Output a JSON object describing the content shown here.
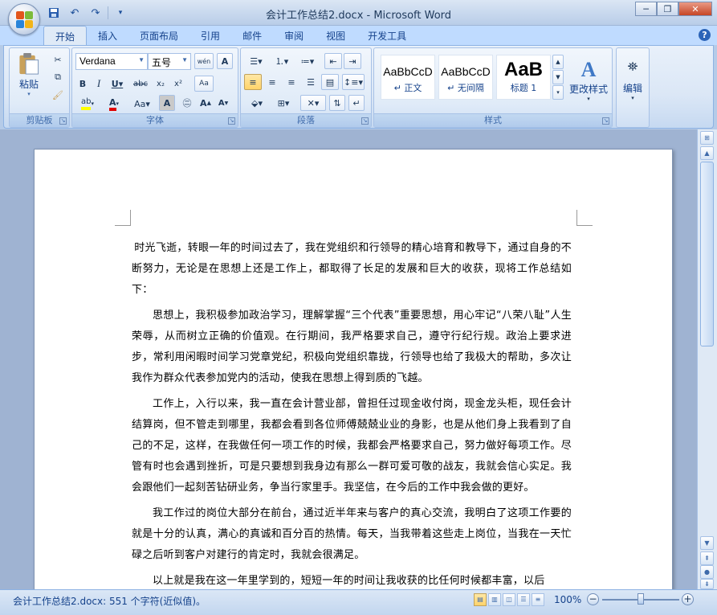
{
  "window": {
    "title": "会计工作总结2.docx - Microsoft Word",
    "minimize": "─",
    "restore": "❐",
    "close": "✕"
  },
  "qat": {
    "save_icon": "save-icon",
    "undo_icon": "undo-icon",
    "redo_icon": "redo-icon",
    "customize_icon": "chevron-down-icon"
  },
  "tabs": [
    {
      "label": "开始",
      "active": true
    },
    {
      "label": "插入"
    },
    {
      "label": "页面布局"
    },
    {
      "label": "引用"
    },
    {
      "label": "邮件"
    },
    {
      "label": "审阅"
    },
    {
      "label": "视图"
    },
    {
      "label": "开发工具"
    }
  ],
  "ribbon": {
    "clipboard": {
      "label": "剪贴板",
      "paste": "粘贴"
    },
    "font": {
      "label": "字体",
      "font_name": "Verdana",
      "font_size": "五号"
    },
    "paragraph": {
      "label": "段落"
    },
    "styles": {
      "label": "样式",
      "items": [
        {
          "sample": "AaBbCcD",
          "name": "↵ 正文"
        },
        {
          "sample": "AaBbCcD",
          "name": "↵ 无间隔"
        },
        {
          "sample": "AaB",
          "name": "标题 1"
        }
      ],
      "change_styles": "更改样式"
    },
    "editing": {
      "label": "编辑"
    }
  },
  "document": {
    "paragraphs": [
      "时光飞逝，转眼一年的时间过去了，我在党组织和行领导的精心培育和教导下，通过自身的不断努力，无论是在思想上还是工作上，都取得了长足的发展和巨大的收获，现将工作总结如下：",
      "思想上，我积极参加政治学习，理解掌握“三个代表”重要思想，用心牢记“八荣八耻”人生荣辱，从而树立正确的价值观。在行期间，我严格要求自己，遵守行纪行规。政治上要求进步，常利用闲暇时间学习党章党纪，积极向党组织靠拢，行领导也给了我极大的帮助，多次让我作为群众代表参加党内的活动，使我在思想上得到质的飞越。",
      "工作上，入行以来，我一直在会计营业部，曾担任过现金收付岗，现金龙头柜，现任会计结算岗，但不管走到哪里，我都会看到各位师傅兢兢业业的身影，也是从他们身上我看到了自己的不足，这样，在我做任何一项工作的时候，我都会严格要求自己，努力做好每项工作。尽管有时也会遇到挫折，可是只要想到我身边有那么一群可爱可敬的战友，我就会信心实足。我会跟他们一起刻苦钻研业务，争当行家里手。我坚信，在今后的工作中我会做的更好。",
      "我工作过的岗位大部分在前台，通过近半年来与客户的真心交流，我明白了这项工作要的就是十分的认真，满心的真诚和百分百的热情。每天，当我带着这些走上岗位，当我在一天忙碌之后听到客户对建行的肯定时，我就会很满足。",
      "以上就是我在这一年里学到的，短短一年的时间让我收获的比任何时候都丰富，以后"
    ]
  },
  "statusbar": {
    "text": "会计工作总结2.docx: 551 个字符(近似值)。",
    "zoom": "100%",
    "zoom_fraction": 0.5
  }
}
